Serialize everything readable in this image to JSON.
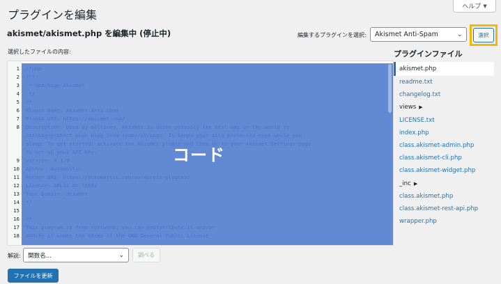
{
  "header": {
    "help_label": "ヘルプ",
    "page_title": "プラグインを編集",
    "editing_file": "akismet/akismet.php を編集中 (停止中)"
  },
  "plugin_picker": {
    "label": "編集するプラグインを選択:",
    "selected": "Akismet Anti-Spam",
    "select_button": "選択"
  },
  "editor": {
    "content_label": "選択したファイルの内容:",
    "overlay_text": "コード",
    "lines": [
      {
        "num": "1",
        "text": "<?php"
      },
      {
        "num": "2",
        "text": "/**"
      },
      {
        "num": "3",
        "text": " * @package Akismet"
      },
      {
        "num": "4",
        "text": " */"
      },
      {
        "num": "5",
        "text": "/*"
      },
      {
        "num": "6",
        "text": "Plugin Name: Akismet Anti-Spam"
      },
      {
        "num": "7",
        "text": "Plugin URI: https://akismet.com/"
      },
      {
        "num": "8",
        "text": "Description: Used by millions, Akismet is quite possibly the best way in the world to"
      },
      {
        "num": "",
        "text": "<strong>protect your blog from spam</strong>. It keeps your site protected even while you"
      },
      {
        "num": "",
        "text": "sleep. To get started: activate the Akismet plugin and then go to your Akismet Settings page"
      },
      {
        "num": "",
        "text": "to set up your API key."
      },
      {
        "num": "9",
        "text": "Version: 4.1.9"
      },
      {
        "num": "10",
        "text": "Author: Automattic"
      },
      {
        "num": "11",
        "text": "Author URI: https://automattic.com/wordpress-plugins/"
      },
      {
        "num": "12",
        "text": "License: GPLv2 or later"
      },
      {
        "num": "13",
        "text": "Text Domain: akismet"
      },
      {
        "num": "14",
        "text": "*/"
      },
      {
        "num": "15",
        "text": ""
      },
      {
        "num": "16",
        "text": "/*"
      },
      {
        "num": "17",
        "text": "This program is free software; you can redistribute it and/or"
      },
      {
        "num": "18",
        "text": "modify it under the terms of the GNU General Public License"
      }
    ]
  },
  "files": {
    "heading": "プラグインファイル",
    "items": [
      {
        "label": "akismet.php",
        "type": "active"
      },
      {
        "label": "readme.txt",
        "type": "file"
      },
      {
        "label": "changelog.txt",
        "type": "file"
      },
      {
        "label": "views",
        "type": "folder"
      },
      {
        "label": "LICENSE.txt",
        "type": "file"
      },
      {
        "label": "index.php",
        "type": "file"
      },
      {
        "label": "class.akismet-admin.php",
        "type": "file"
      },
      {
        "label": "class.akismet-cli.php",
        "type": "file"
      },
      {
        "label": "class.akismet-widget.php",
        "type": "file"
      },
      {
        "label": "_inc",
        "type": "folder"
      },
      {
        "label": "class.akismet.php",
        "type": "file"
      },
      {
        "label": "class.akismet-rest-api.php",
        "type": "file"
      },
      {
        "label": "wrapper.php",
        "type": "file"
      }
    ]
  },
  "footer": {
    "doc_label": "解説:",
    "doc_select": "関数名...",
    "lookup_button": "調べる",
    "update_button": "ファイルを更新"
  },
  "colors": {
    "accent": "#2271b1",
    "highlight": "#f5b800",
    "overlay": "#4c79ce"
  }
}
